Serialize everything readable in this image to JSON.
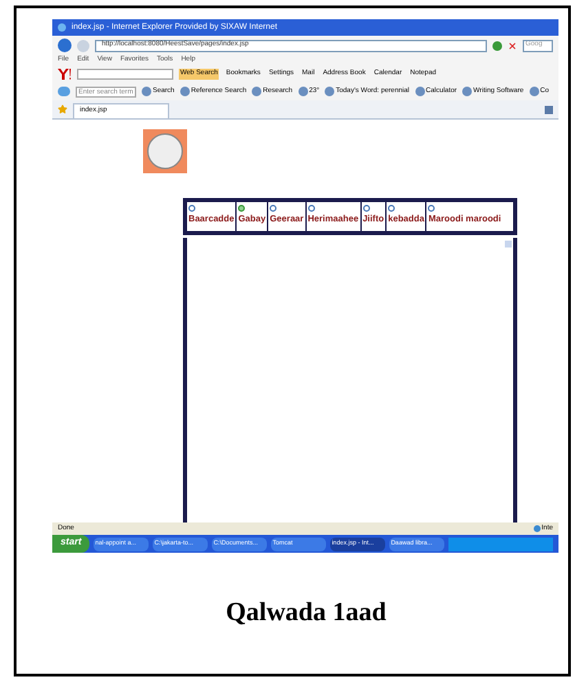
{
  "window": {
    "title": "index.jsp - Internet Explorer Provided by SIXAW Internet"
  },
  "address_bar": {
    "url": "http://localhost:8080/HeestSave/pages/index.jsp",
    "search": "Goog"
  },
  "menu": [
    "File",
    "Edit",
    "View",
    "Favorites",
    "Tools",
    "Help"
  ],
  "toolbar_1": [
    "Web Search",
    "Bookmarks",
    "Settings",
    "Mail",
    "Address Book",
    "Calendar",
    "Notepad"
  ],
  "toolbar_2": {
    "search_placeholder": "Enter search term",
    "items": [
      "Search",
      "Reference Search",
      "Research",
      "23°",
      "Today's Word: perennial",
      "Calculator",
      "Writing Software",
      "Co"
    ]
  },
  "tabs": [
    {
      "label": "index.jsp",
      "selected": true
    }
  ],
  "page": {
    "options": [
      {
        "label": "Baarcadde",
        "selected": false
      },
      {
        "label": "Gabay",
        "selected": true
      },
      {
        "label": "Geeraar",
        "selected": false
      },
      {
        "label": "Herimaahee",
        "selected": false
      },
      {
        "label": "Jiifto",
        "selected": false
      },
      {
        "label": "kebadda",
        "selected": false
      },
      {
        "label": "Maroodi maroodi",
        "selected": false
      }
    ]
  },
  "status_bar": {
    "text": "Done",
    "zone": "Inte"
  },
  "taskbar": {
    "start": "start",
    "items": [
      {
        "label": "nal-appoint a...",
        "selected": false
      },
      {
        "label": "C:\\jakarta-to...",
        "selected": false
      },
      {
        "label": "C:\\Documents...",
        "selected": false
      },
      {
        "label": "Tomcat",
        "selected": false
      },
      {
        "label": "index.jsp - Int...",
        "selected": true
      },
      {
        "label": "Daawad libra...",
        "selected": false
      }
    ]
  },
  "caption": "Qalwada 1aad"
}
